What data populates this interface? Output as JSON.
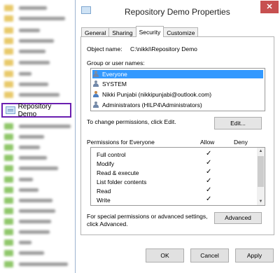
{
  "explorer": {
    "highlighted_item_label": "Repository Demo"
  },
  "dialog": {
    "title": "Repository Demo Properties",
    "close_glyph": "✕",
    "tabs": [
      "General",
      "Sharing",
      "Security",
      "Customize"
    ],
    "active_tab": "Security",
    "object_name_label": "Object name:",
    "object_name_value": "C:\\nikki\\Repository Demo",
    "group_label": "Group or user names:",
    "users": [
      {
        "name": "Everyone",
        "icon": "group-icon",
        "selected": true
      },
      {
        "name": "SYSTEM",
        "icon": "group-icon",
        "selected": false
      },
      {
        "name": "Nikki Punjabi (nikkipunjabi@outlook.com)",
        "icon": "user-icon",
        "selected": false
      },
      {
        "name": "Administrators (HILP4\\Administrators)",
        "icon": "group-icon",
        "selected": false
      }
    ],
    "change_permissions_text": "To change permissions, click Edit.",
    "edit_button": "Edit...",
    "permissions_for_label": "Permissions for Everyone",
    "allow_header": "Allow",
    "deny_header": "Deny",
    "check_glyph": "✓",
    "permissions": [
      {
        "name": "Full control",
        "allow": true,
        "deny": false
      },
      {
        "name": "Modify",
        "allow": true,
        "deny": false
      },
      {
        "name": "Read & execute",
        "allow": true,
        "deny": false
      },
      {
        "name": "List folder contents",
        "allow": true,
        "deny": false
      },
      {
        "name": "Read",
        "allow": true,
        "deny": false
      },
      {
        "name": "Write",
        "allow": true,
        "deny": false
      }
    ],
    "special_text_line1": "For special permissions or advanced settings,",
    "special_text_line2": "click Advanced.",
    "advanced_button": "Advanced",
    "ok_button": "OK",
    "cancel_button": "Cancel",
    "apply_button": "Apply"
  },
  "colors": {
    "selection": "#3399ff",
    "highlight_border": "#6a1fb0",
    "close_button": "#c75050"
  }
}
